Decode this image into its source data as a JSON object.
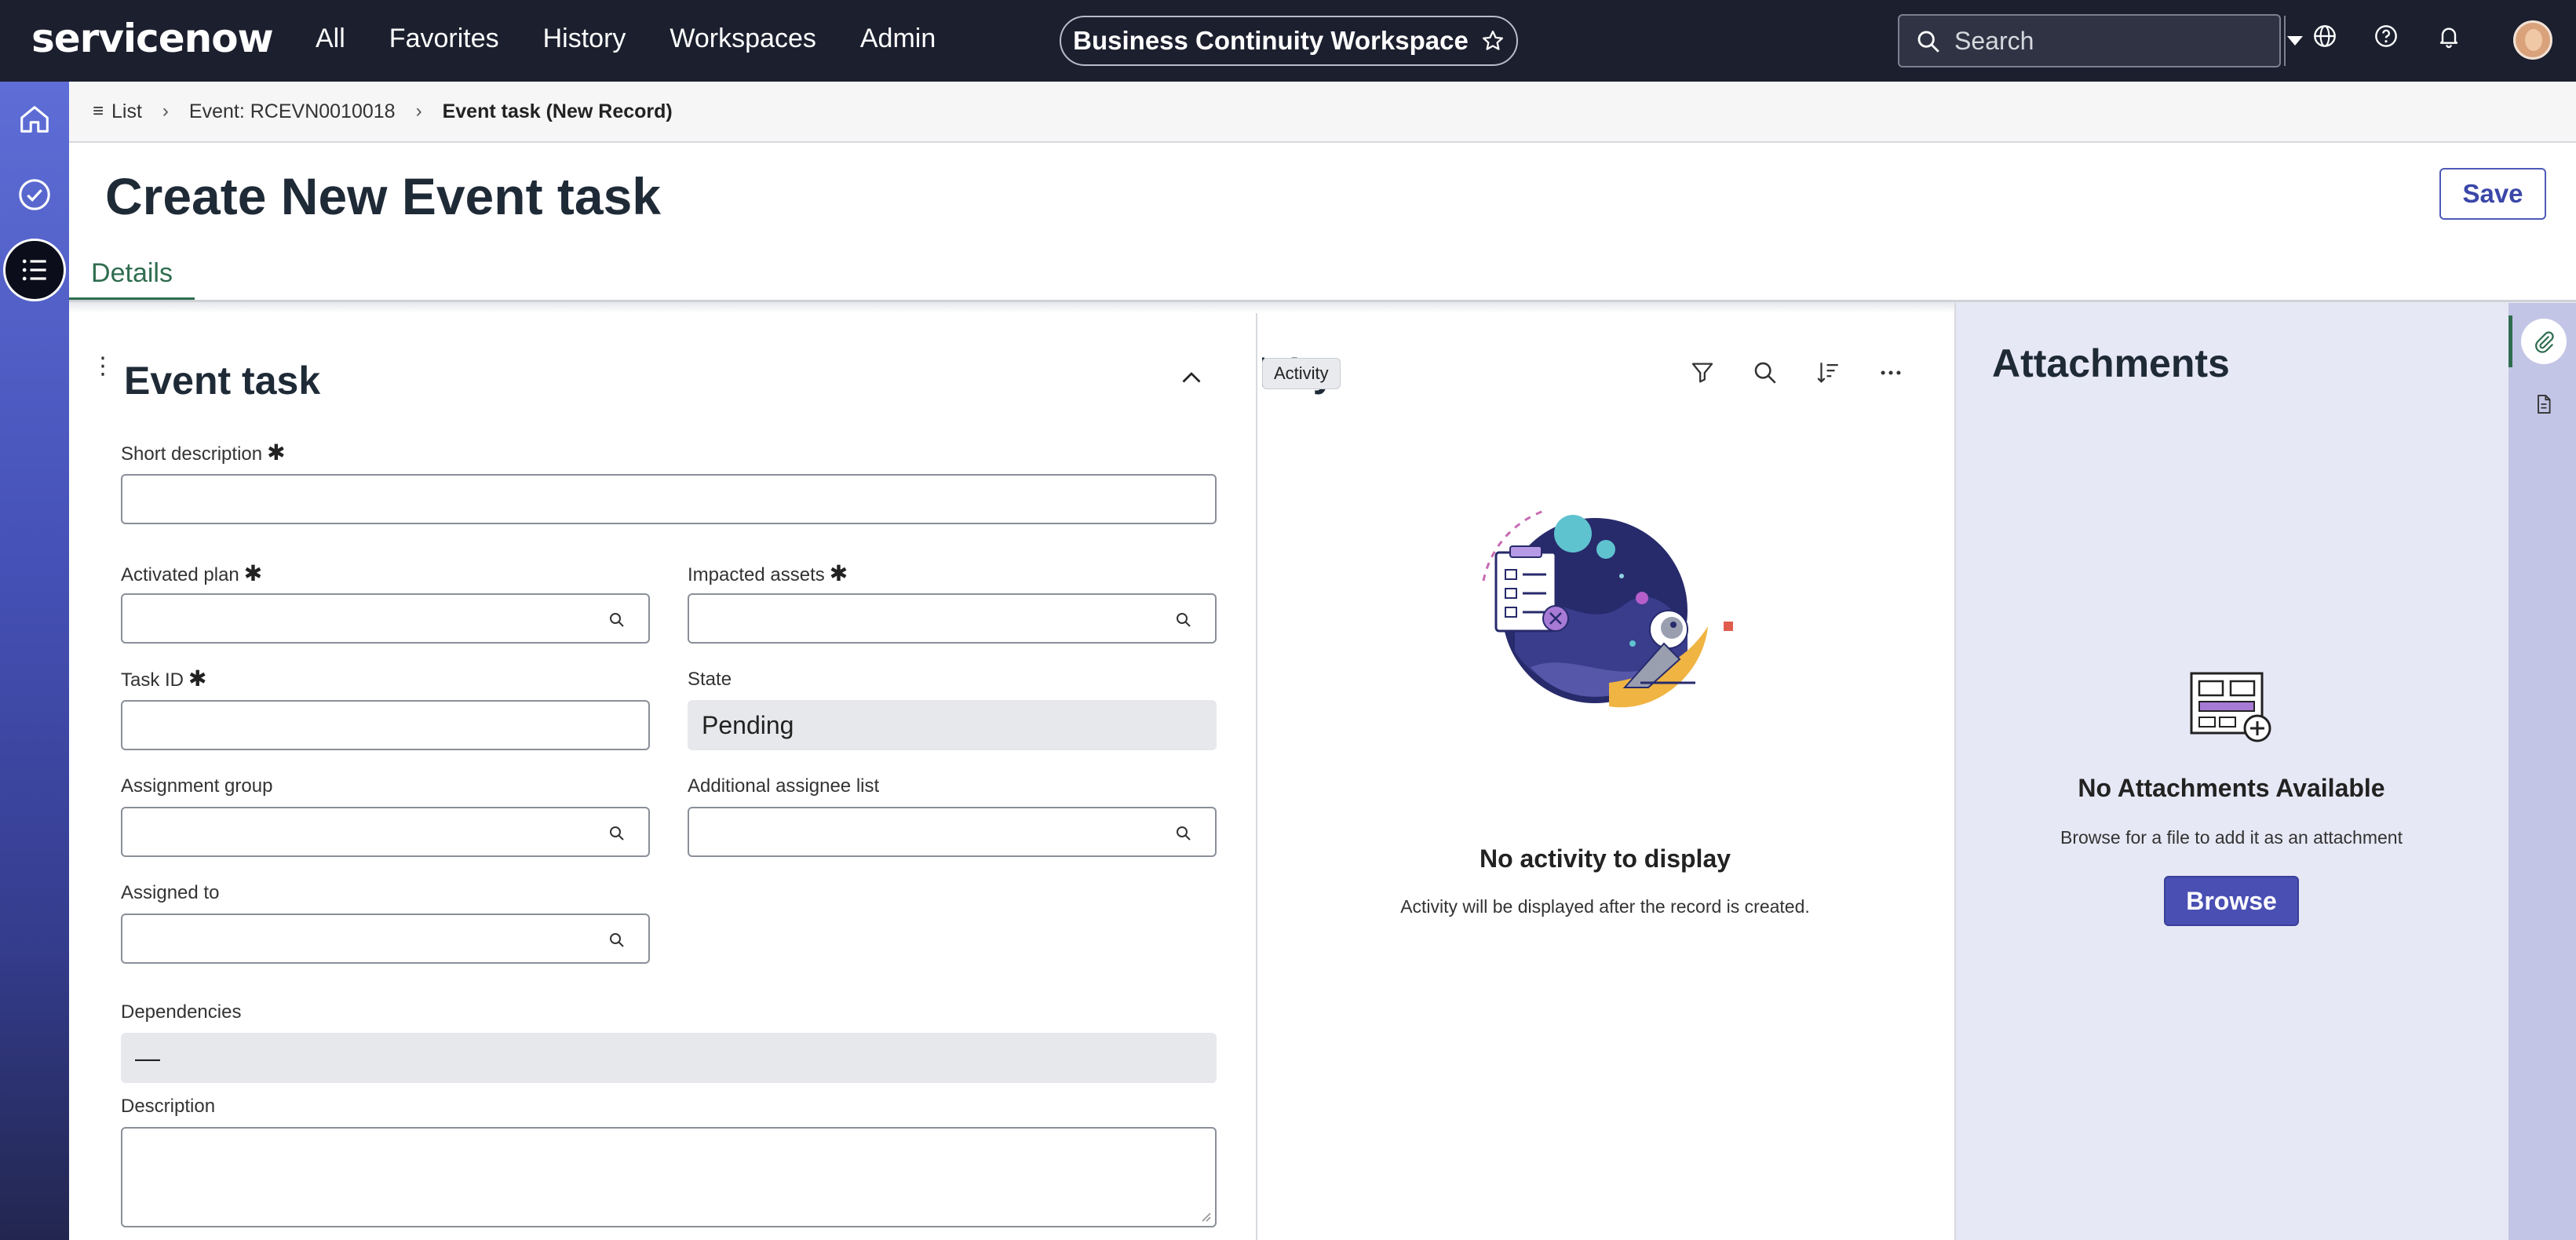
{
  "app": {
    "logo": "servicenow",
    "nav": [
      "All",
      "Favorites",
      "History",
      "Workspaces",
      "Admin"
    ],
    "workspace_title": "Business Continuity Workspace",
    "search_placeholder": "Search"
  },
  "breadcrumb": {
    "list": "List",
    "event": "Event: RCEVN0010018",
    "current": "Event task (New Record)"
  },
  "header": {
    "title": "Create New Event task",
    "save_label": "Save",
    "tab": "Details"
  },
  "form": {
    "section_title": "Event task",
    "short_description_label": "Short description",
    "activated_plan_label": "Activated plan",
    "impacted_assets_label": "Impacted assets",
    "task_id_label": "Task ID",
    "state_label": "State",
    "state_value": "Pending",
    "assignment_group_label": "Assignment group",
    "additional_assignee_label": "Additional assignee list",
    "assigned_to_label": "Assigned to",
    "dependencies_label": "Dependencies",
    "dependencies_value": "—",
    "description_label": "Description",
    "required_marker": "✱"
  },
  "activity": {
    "title": "Activity",
    "tooltip": "Activity",
    "empty_title": "No activity to display",
    "empty_sub": "Activity will be displayed after the record is created."
  },
  "attachments": {
    "title": "Attachments",
    "empty_title": "No Attachments Available",
    "empty_sub": "Browse for a file to add it as an attachment",
    "browse_label": "Browse"
  },
  "colors": {
    "topnav": "#1c1f2e",
    "accent_green": "#2f6d4f",
    "primary_indigo": "#4a4fb3",
    "attach_bg": "#e7e8f5"
  }
}
